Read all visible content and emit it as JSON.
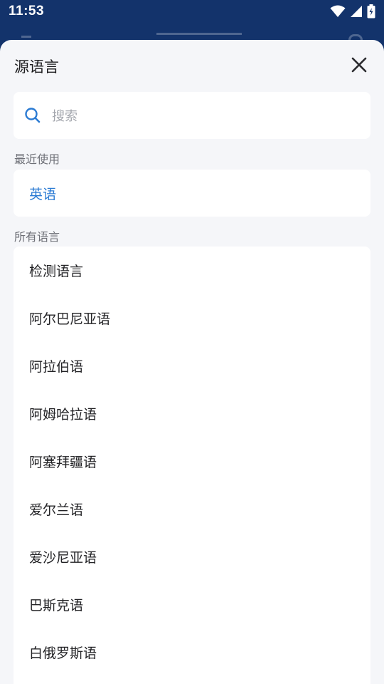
{
  "status_bar": {
    "time": "11:53",
    "icons": [
      "wifi-icon",
      "signal-icon",
      "battery-charging-icon"
    ]
  },
  "sheet": {
    "title": "源语言",
    "close_icon": "close-icon"
  },
  "search": {
    "placeholder": "搜索",
    "value": ""
  },
  "recent": {
    "label": "最近使用",
    "items": [
      {
        "label": "英语"
      }
    ]
  },
  "all": {
    "label": "所有语言",
    "items": [
      {
        "label": "检测语言"
      },
      {
        "label": "阿尔巴尼亚语"
      },
      {
        "label": "阿拉伯语"
      },
      {
        "label": "阿姆哈拉语"
      },
      {
        "label": "阿塞拜疆语"
      },
      {
        "label": "爱尔兰语"
      },
      {
        "label": "爱沙尼亚语"
      },
      {
        "label": "巴斯克语"
      },
      {
        "label": "白俄罗斯语"
      }
    ]
  },
  "colors": {
    "status_bar_bg": "#13336b",
    "sheet_bg": "#f5f6f9",
    "accent": "#2b7bd3"
  }
}
